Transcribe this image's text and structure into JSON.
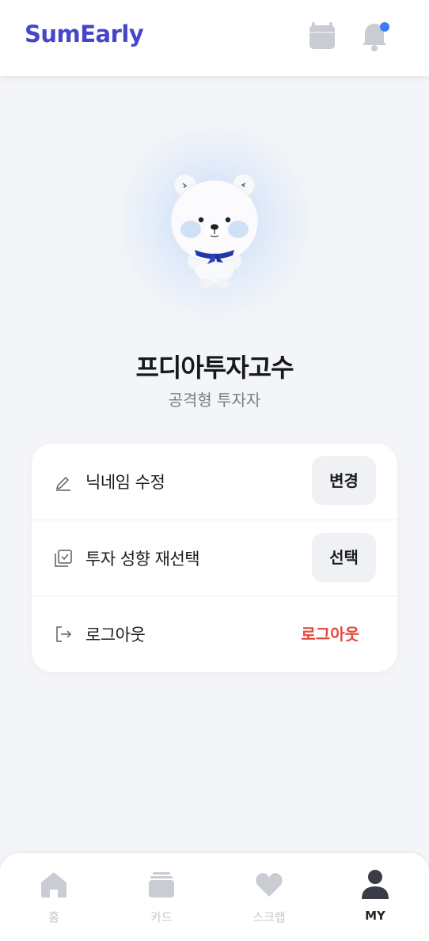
{
  "header": {
    "logo": "SumEarly",
    "calendar_icon": "calendar-icon",
    "bell_icon": "bell-icon",
    "has_notification": true
  },
  "profile": {
    "avatar": "polar-bear-mascot",
    "nickname": "프디아투자고수",
    "investor_type": "공격형 투자자"
  },
  "settings": [
    {
      "icon": "pencil-icon",
      "label": "닉네임 수정",
      "action": "변경"
    },
    {
      "icon": "checklist-icon",
      "label": "투자 성향 재선택",
      "action": "선택"
    },
    {
      "icon": "logout-icon",
      "label": "로그아웃",
      "action": "로그아웃"
    }
  ],
  "bottom_nav": [
    {
      "icon": "home-icon",
      "label": "홈",
      "active": false
    },
    {
      "icon": "cards-icon",
      "label": "카드",
      "active": false
    },
    {
      "icon": "heart-icon",
      "label": "스크랩",
      "active": false
    },
    {
      "icon": "person-icon",
      "label": "MY",
      "active": true
    }
  ],
  "colors": {
    "brand": "#4646c8",
    "notification_dot": "#3d7cf4",
    "logout_red": "#e8453c",
    "nav_inactive": "#c4c7ce",
    "nav_active": "#22252b"
  }
}
